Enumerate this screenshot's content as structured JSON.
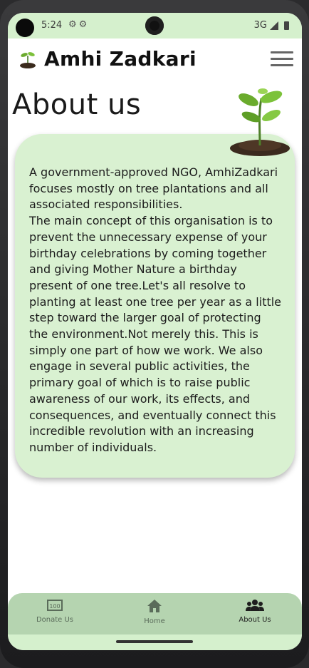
{
  "status_bar": {
    "time": "5:24",
    "left_icons": [
      "settings-icon",
      "settings-icon"
    ],
    "network": "3G"
  },
  "app_bar": {
    "title": "Amhi Zadkari",
    "menu_icon": "hamburger-menu-icon"
  },
  "page": {
    "heading": "About us",
    "body": "A government-approved NGO, AmhiZadkari focuses mostly on tree plantations and all associated responsibilities.\nThe main concept of this organisation is to prevent the unnecessary expense of your birthday celebrations by coming together and giving Mother Nature a birthday present of one tree.Let's all resolve to planting at least one tree per year as a little step toward the larger goal of protecting the environment.Not merely this. This is simply one part of how we work. We also engage in several public activities, the primary goal of which is to raise public awareness of our work, its effects, and consequences, and eventually connect this incredible revolution with an increasing number of individuals."
  },
  "bottom_nav": {
    "items": [
      {
        "label": "Donate Us",
        "icon": "money-icon",
        "active": false
      },
      {
        "label": "Home",
        "icon": "home-icon",
        "active": false
      },
      {
        "label": "About Us",
        "icon": "group-icon",
        "active": true
      }
    ]
  },
  "colors": {
    "status_bar": "#d5f0cd",
    "card": "#d9f1d1",
    "bottom_nav": "#b5d4b0"
  }
}
